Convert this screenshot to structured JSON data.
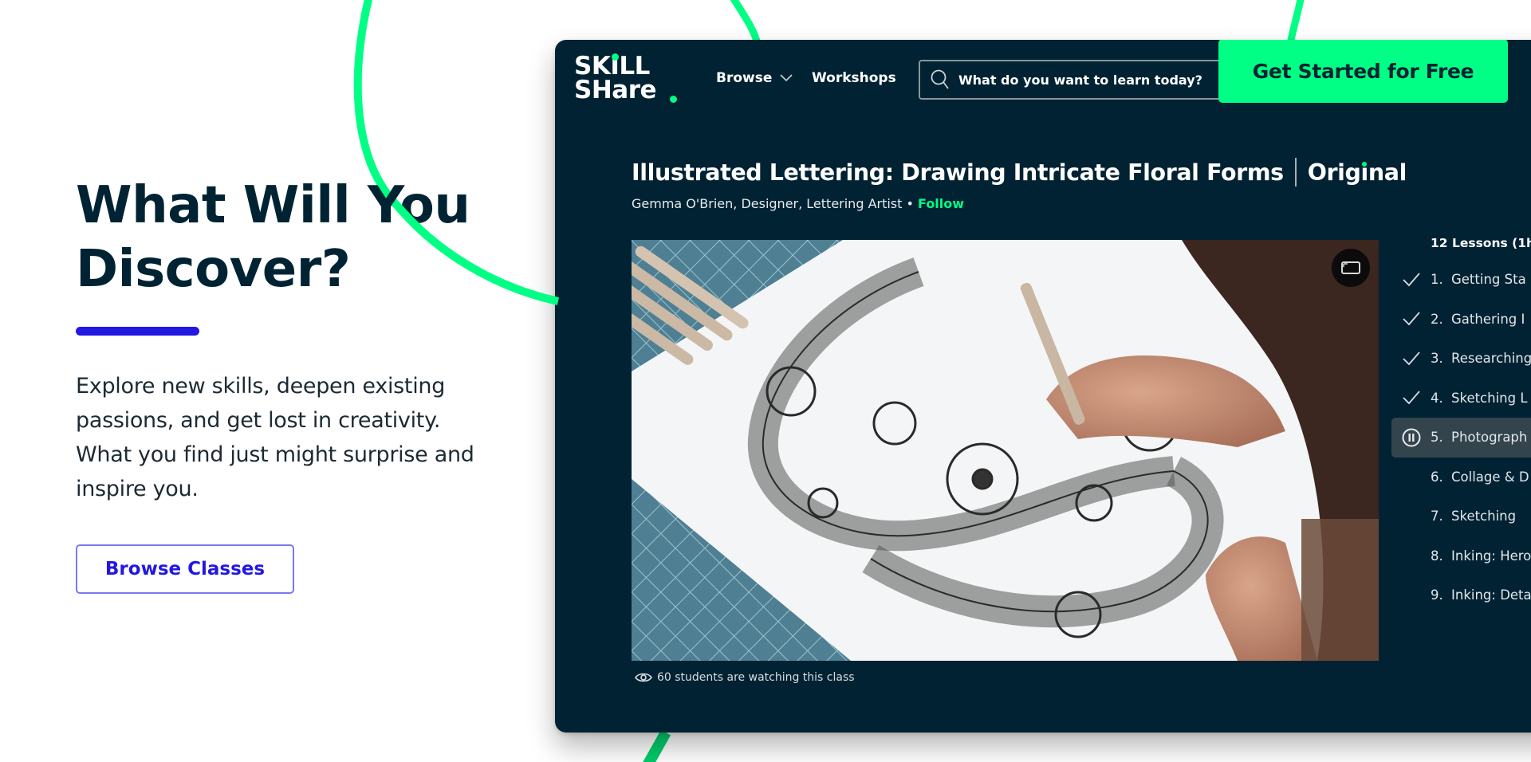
{
  "hero": {
    "title_line1": "What Will You",
    "title_line2": "Discover?",
    "body": "Explore new skills, deepen existing passions, and get lost in creativity. What you find just might surprise and inspire you.",
    "browse_button": "Browse Classes"
  },
  "header": {
    "logo_line1": "SKILL",
    "logo_line2": "SHare",
    "nav_browse": "Browse",
    "nav_workshops": "Workshops",
    "search_placeholder": "What do you want to learn today?",
    "cta": "Get Started for Free"
  },
  "class": {
    "title": "Illustrated Lettering: Drawing Intricate Floral Forms",
    "badge_pre": "Orig",
    "badge_i": "ı",
    "badge_post": "nal",
    "author": "Gemma O'Brien, Designer, Lettering Artist",
    "separator": " • ",
    "follow": "Follow",
    "watching": "60 students are watching this class"
  },
  "lessons": {
    "header": "12 Lessons (1h",
    "items": [
      {
        "num": "1.",
        "title": "Getting Sta",
        "status": "completed"
      },
      {
        "num": "2.",
        "title": "Gathering I",
        "status": "completed"
      },
      {
        "num": "3.",
        "title": "Researching",
        "status": "completed"
      },
      {
        "num": "4.",
        "title": "Sketching L",
        "status": "completed"
      },
      {
        "num": "5.",
        "title": "Photograph",
        "status": "playing"
      },
      {
        "num": "6.",
        "title": "Collage & D",
        "status": "none"
      },
      {
        "num": "7.",
        "title": "Sketching",
        "status": "none"
      },
      {
        "num": "8.",
        "title": "Inking: Hero",
        "status": "none"
      },
      {
        "num": "9.",
        "title": "Inking: Deta",
        "status": "none"
      }
    ]
  },
  "colors": {
    "brand_green": "#00ff84",
    "navy": "#002233",
    "accent_blue": "#2318e0"
  }
}
